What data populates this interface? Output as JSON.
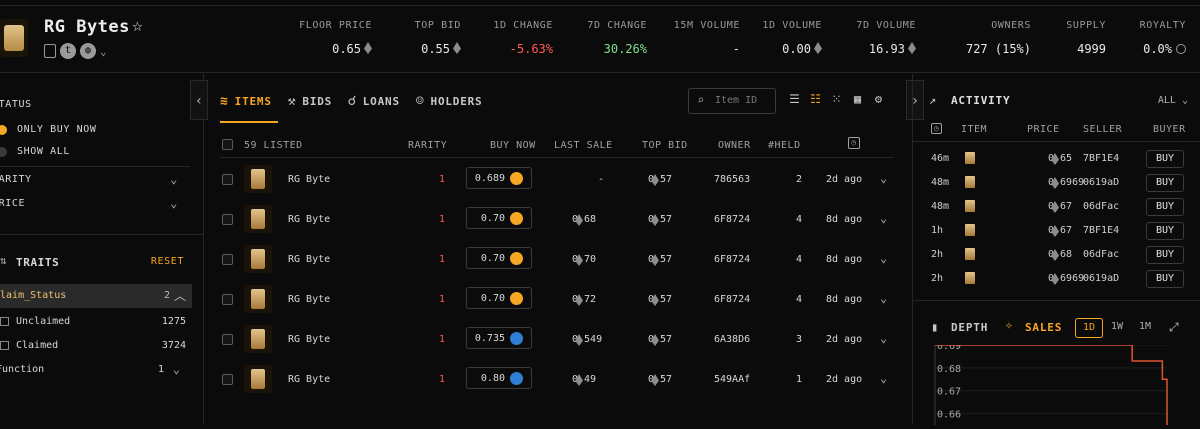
{
  "collection": {
    "name": "RG Bytes",
    "stats": [
      {
        "label": "FLOOR PRICE",
        "value": "0.65",
        "eth": true
      },
      {
        "label": "TOP BID",
        "value": "0.55",
        "eth": true
      },
      {
        "label": "1D CHANGE",
        "value": "-5.63%",
        "color": "red"
      },
      {
        "label": "7D CHANGE",
        "value": "30.26%",
        "color": "green"
      },
      {
        "label": "15M VOLUME",
        "value": "-"
      },
      {
        "label": "1D VOLUME",
        "value": "0.00",
        "eth": true
      },
      {
        "label": "7D VOLUME",
        "value": "16.93",
        "eth": true
      },
      {
        "label": "OWNERS",
        "value": "727 (15%)"
      },
      {
        "label": "SUPPLY",
        "value": "4999"
      },
      {
        "label": "ROYALTY",
        "value": "0.0%",
        "eth": false,
        "info": true
      }
    ]
  },
  "sidebar": {
    "status_title": "STATUS",
    "status_options": [
      "ONLY BUY NOW",
      "SHOW ALL"
    ],
    "rarity_label": "RARITY",
    "price_label": "PRICE",
    "traits_title": "TRAITS",
    "reset_label": "RESET",
    "trait_selected": {
      "name": "Claim_Status",
      "count": "2"
    },
    "trait_values": [
      {
        "name": "Unclaimed",
        "count": "1275"
      },
      {
        "name": "Claimed",
        "count": "3724"
      }
    ],
    "trait_other": {
      "name": "Function",
      "count": "1"
    }
  },
  "main": {
    "tabs": [
      {
        "label": "ITEMS",
        "icon": "layers-icon",
        "active": true
      },
      {
        "label": "BIDS",
        "icon": "gavel-icon",
        "active": false
      },
      {
        "label": "LOANS",
        "icon": "hand-coin-icon",
        "active": false
      },
      {
        "label": "HOLDERS",
        "icon": "users-icon",
        "active": false
      }
    ],
    "search_placeholder": "Item ID",
    "columns": {
      "listed": "59 LISTED",
      "rarity": "RARITY",
      "buy_now": "BUY NOW",
      "last_sale": "LAST SALE",
      "top_bid": "TOP BID",
      "owner": "OWNER",
      "held": "#HELD"
    },
    "rows": [
      {
        "name": "RG Byte",
        "rarity": "1",
        "buy": "0.689",
        "coin": "o",
        "last": "-",
        "last_eth": false,
        "bid": "0.57",
        "owner": "786563",
        "held": "2",
        "time": "2d ago"
      },
      {
        "name": "RG Byte",
        "rarity": "1",
        "buy": "0.70",
        "coin": "o",
        "last": "0.68",
        "last_eth": true,
        "bid": "0.57",
        "owner": "6F8724",
        "held": "4",
        "time": "8d ago"
      },
      {
        "name": "RG Byte",
        "rarity": "1",
        "buy": "0.70",
        "coin": "o",
        "last": "0.70",
        "last_eth": true,
        "bid": "0.57",
        "owner": "6F8724",
        "held": "4",
        "time": "8d ago"
      },
      {
        "name": "RG Byte",
        "rarity": "1",
        "buy": "0.70",
        "coin": "o",
        "last": "0.72",
        "last_eth": true,
        "bid": "0.57",
        "owner": "6F8724",
        "held": "4",
        "time": "8d ago"
      },
      {
        "name": "RG Byte",
        "rarity": "1",
        "buy": "0.735",
        "coin": "b",
        "last": "0.549",
        "last_eth": true,
        "bid": "0.57",
        "owner": "6A38D6",
        "held": "3",
        "time": "2d ago"
      },
      {
        "name": "RG Byte",
        "rarity": "1",
        "buy": "0.80",
        "coin": "b",
        "last": "0.49",
        "last_eth": true,
        "bid": "0.57",
        "owner": "549AAf",
        "held": "1",
        "time": "2d ago"
      }
    ]
  },
  "activity": {
    "title": "ACTIVITY",
    "filter": "ALL",
    "columns": {
      "item": "ITEM",
      "price": "PRICE",
      "seller": "SELLER",
      "buyer": "BUYER"
    },
    "rows": [
      {
        "time": "46m",
        "price": "0.65",
        "seller": "7BF1E4",
        "buyer": "BUY"
      },
      {
        "time": "48m",
        "price": "0.6969",
        "seller": "0619aD",
        "buyer": "BUY"
      },
      {
        "time": "48m",
        "price": "0.67",
        "seller": "06dFac",
        "buyer": "BUY"
      },
      {
        "time": "1h",
        "price": "0.67",
        "seller": "7BF1E4",
        "buyer": "BUY"
      },
      {
        "time": "2h",
        "price": "0.68",
        "seller": "06dFac",
        "buyer": "BUY"
      },
      {
        "time": "2h",
        "price": "0.6969",
        "seller": "0619aD",
        "buyer": "BUY"
      }
    ]
  },
  "chart": {
    "tabs": [
      "DEPTH",
      "SALES"
    ],
    "ranges": [
      "1D",
      "1W",
      "1M"
    ],
    "active_range": "1D"
  },
  "chart_data": {
    "type": "line",
    "title": "",
    "ylabel": "",
    "y_ticks": [
      "0.69",
      "0.68",
      "0.67",
      "0.66"
    ],
    "ylim": [
      0.655,
      0.69
    ],
    "series": [
      {
        "points": [
          [
            0.0,
            0.69
          ],
          [
            0.85,
            0.69
          ],
          [
            0.85,
            0.683
          ],
          [
            0.98,
            0.683
          ],
          [
            0.98,
            0.675
          ],
          [
            1.0,
            0.675
          ],
          [
            1.0,
            0.655
          ]
        ]
      }
    ],
    "line_color": "#e0532f"
  },
  "colors": {
    "accent": "#f5a623",
    "negative": "#ff5a4f",
    "positive": "#7ee08a"
  }
}
